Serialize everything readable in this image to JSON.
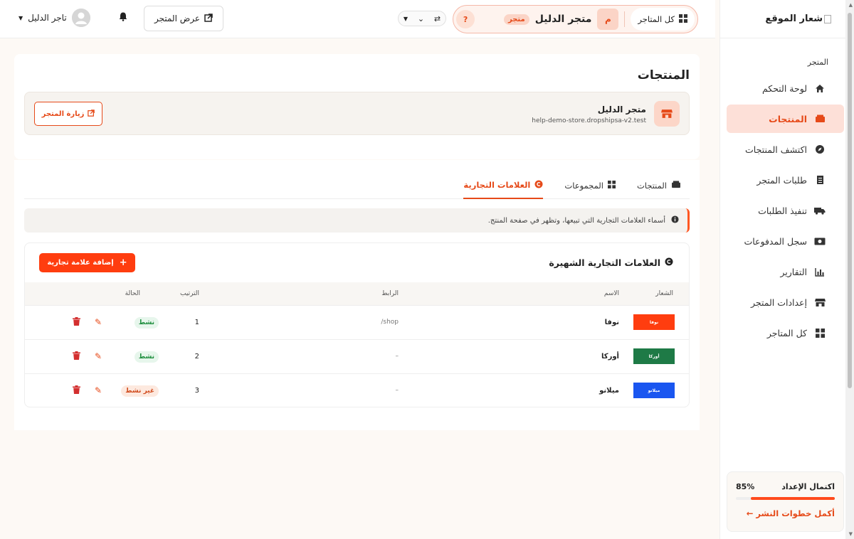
{
  "sidebar": {
    "logo_text": "شعار الموقع",
    "section_label": "المتجر",
    "items": [
      {
        "label": "لوحة التحكم",
        "icon": "home-icon"
      },
      {
        "label": "المنتجات",
        "icon": "boxes-icon"
      },
      {
        "label": "اكتشف المنتجات",
        "icon": "compass-icon"
      },
      {
        "label": "طلبات المتجر",
        "icon": "receipt-icon"
      },
      {
        "label": "تنفيذ الطلبات",
        "icon": "truck-icon"
      },
      {
        "label": "سجل المدفوعات",
        "icon": "money-icon"
      },
      {
        "label": "التقارير",
        "icon": "chart-icon"
      },
      {
        "label": "إعدادات المتجر",
        "icon": "store-icon"
      },
      {
        "label": "كل المتاجر",
        "icon": "grid-icon"
      }
    ],
    "progress": {
      "label": "اكتمال الإعداد",
      "percent_text": "85%",
      "percent": 85,
      "link": "أكمل خطوات النشر ←"
    }
  },
  "topbar": {
    "all_stores": "كل المتاجر",
    "store_initial": "م",
    "store_name": "متجر الدليل",
    "store_tag": "متجر",
    "help": "?",
    "view_store": "عرض المتجر",
    "user_name": "تاجر الدليل"
  },
  "page": {
    "title": "المنتجات",
    "store_name": "متجر الدليل",
    "store_url": "help-demo-store.dropshipsa-v2.test",
    "visit_store": "زيارة المتجر"
  },
  "tabs": [
    {
      "label": "المنتجات",
      "icon": "boxes-icon"
    },
    {
      "label": "المجموعات",
      "icon": "grid-icon"
    },
    {
      "label": "العلامات التجارية",
      "icon": "copyright-icon"
    }
  ],
  "info_text": "أسماء العلامات التجارية التي تبيعها، وتظهر في صفحة المنتج.",
  "brands": {
    "title": "العلامات التجارية الشهيرة",
    "add_button": "إضافة علامة تجارية",
    "columns": {
      "logo": "الشعار",
      "name": "الاسم",
      "link": "الرابط",
      "order": "الترتيب",
      "status": "الحالة"
    },
    "rows": [
      {
        "logo_text": "نوفا",
        "logo_color": "#ff3d0f",
        "name": "نوفا",
        "link": "shop/",
        "order": "1",
        "status": "نشط",
        "active": true
      },
      {
        "logo_text": "أوركا",
        "logo_color": "#1e7a46",
        "name": "أوركا",
        "link": "–",
        "order": "2",
        "status": "نشط",
        "active": true
      },
      {
        "logo_text": "ميلانو",
        "logo_color": "#1a56f0",
        "name": "ميلانو",
        "link": "–",
        "order": "3",
        "status": "غير نشط",
        "active": false
      }
    ]
  }
}
